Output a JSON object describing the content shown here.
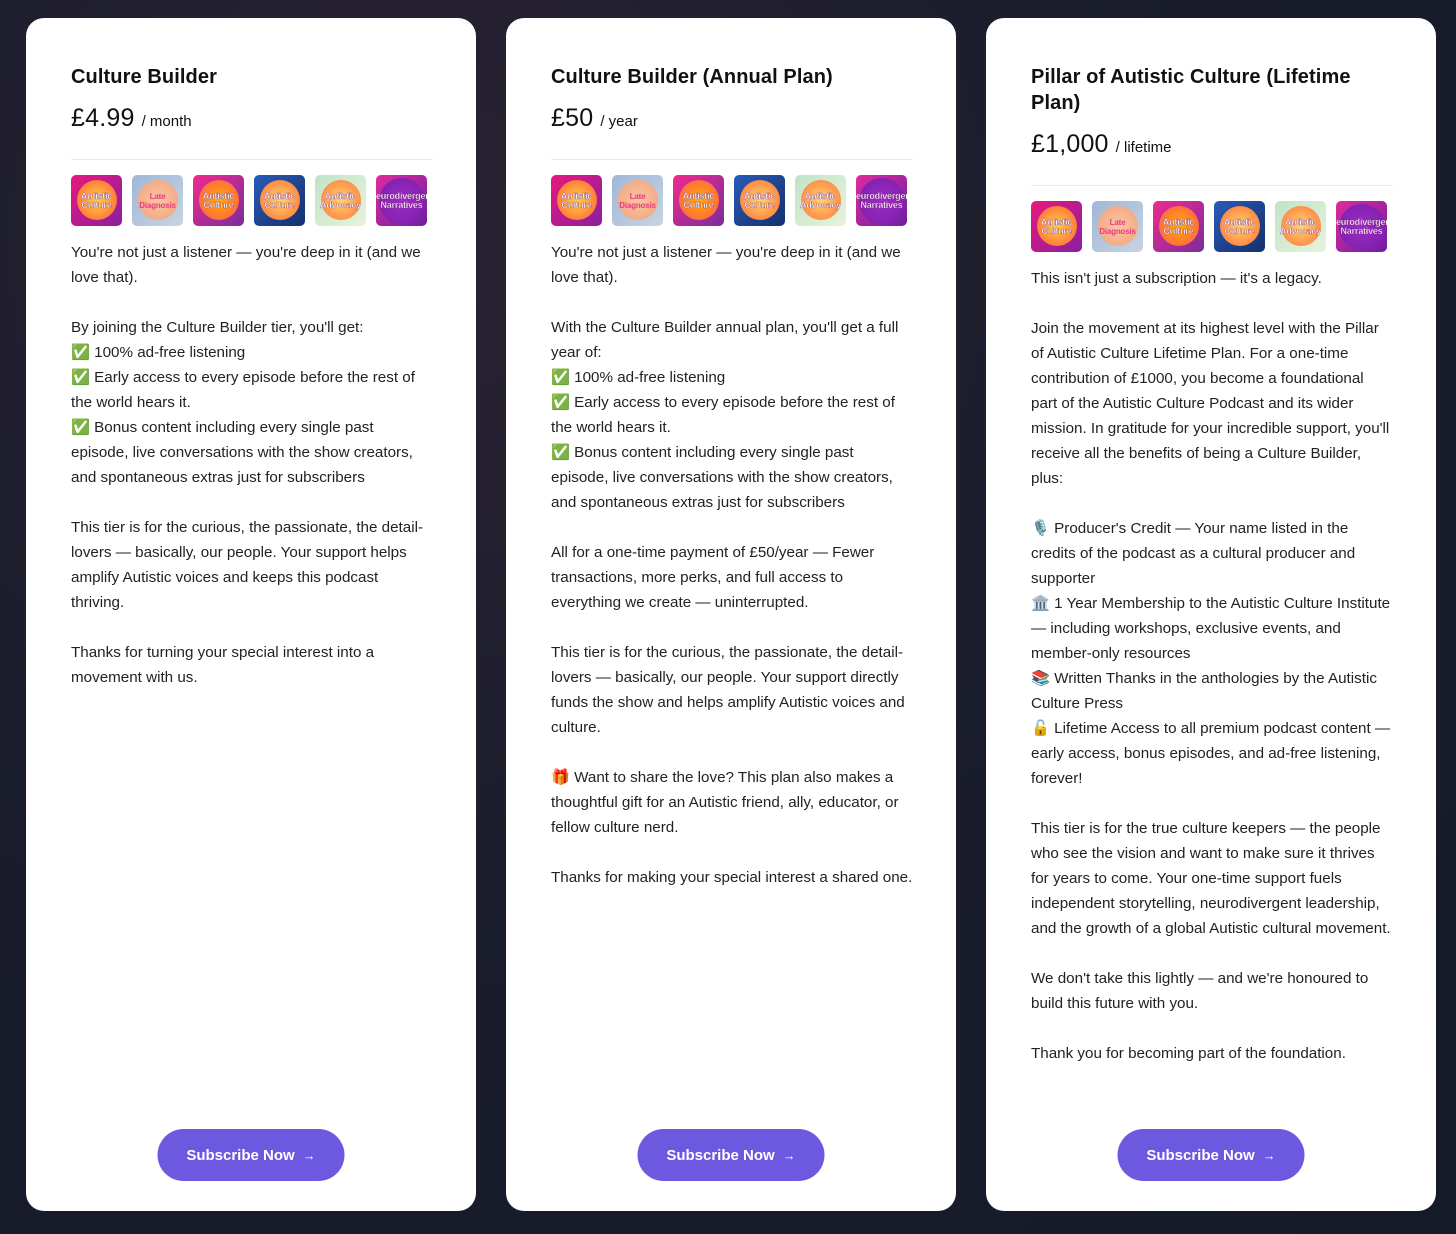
{
  "plans": [
    {
      "title": "Culture Builder",
      "price": "£4.99",
      "period": "/ month",
      "paragraphs": [
        [
          "You're not just a listener — you're deep in it (and we love that)."
        ],
        [
          "By joining the Culture Builder tier, you'll get:",
          "✅ 100% ad-free listening",
          "✅ Early access to every episode before the rest of the world hears it.",
          "✅ Bonus content including every single past episode, live conversations with the show creators, and spontaneous extras just for subscribers"
        ],
        [
          "This tier is for the curious, the passionate, the detail-lovers — basically, our people. Your support helps amplify Autistic voices and keeps this podcast thriving."
        ],
        [
          "Thanks for turning your special interest into a movement with us."
        ]
      ],
      "button_label": "Subscribe Now",
      "button_arrow": "→"
    },
    {
      "title": "Culture Builder (Annual Plan)",
      "price": "£50",
      "period": "/ year",
      "paragraphs": [
        [
          "You're not just a listener — you're deep in it (and we love that)."
        ],
        [
          "With the Culture Builder annual plan, you'll get a full year of:",
          "✅ 100% ad-free listening",
          "✅ Early access to every episode before the rest of the world hears it.",
          "✅ Bonus content including every single past episode, live conversations with the show creators, and spontaneous extras just for subscribers"
        ],
        [
          "All for a one-time payment of £50/year — Fewer transactions, more perks, and full access to everything we create — uninterrupted."
        ],
        [
          "This tier is for the curious, the passionate, the detail-lovers — basically, our people. Your support directly funds the show and helps amplify Autistic voices and culture."
        ],
        [
          "🎁 Want to share the love? This plan also makes a thoughtful gift for an Autistic friend, ally, educator, or fellow culture nerd."
        ],
        [
          "Thanks for making your special interest a shared one."
        ]
      ],
      "button_label": "Subscribe Now",
      "button_arrow": "→"
    },
    {
      "title": "Pillar of Autistic Culture (Lifetime Plan)",
      "price": "£1,000",
      "period": "/ lifetime",
      "paragraphs": [
        [
          "This isn't just a subscription — it's a legacy."
        ],
        [
          "Join the movement at its highest level with the Pillar of Autistic Culture Lifetime Plan. For a one-time contribution of £1000, you become a foundational part of the Autistic Culture Podcast and its wider mission. In gratitude for your incredible support, you'll receive all the benefits of being a Culture Builder, plus:"
        ],
        [
          "🎙️ Producer's Credit — Your name listed in the credits of the podcast as a cultural producer and supporter",
          "🏛️ 1 Year Membership to the Autistic Culture Institute — including workshops, exclusive events, and member-only resources",
          "📚 Written Thanks in the anthologies by the Autistic Culture Press",
          "🔓 Lifetime Access to all premium podcast content — early access, bonus episodes, and ad-free listening, forever!"
        ],
        [
          "This tier is for the true culture keepers — the people who see the vision and want to make sure it thrives for years to come. Your one-time support fuels independent storytelling, neurodivergent leadership, and the growth of a global Autistic cultural movement."
        ],
        [
          "We don't take this lightly — and we're honoured to build this future with you."
        ],
        [
          "Thank you for becoming part of the foundation."
        ]
      ],
      "button_label": "Subscribe Now",
      "button_arrow": "→"
    }
  ],
  "podcast_icons": [
    {
      "name": "autistic-culture-icon",
      "label": "Autistic Culture",
      "style": "ic-ac"
    },
    {
      "name": "late-diagnosis-icon",
      "label": "Late Diagnosis",
      "style": "ic-late"
    },
    {
      "name": "autistic-culture-plus-icon",
      "label": "Autistic Culture",
      "style": "ic-ac2"
    },
    {
      "name": "autistic-culture-blue-icon",
      "label": "Autistic Culture",
      "style": "ic-ac3"
    },
    {
      "name": "autistic-advocacy-icon",
      "label": "Autistic Advocacy",
      "style": "ic-adv"
    },
    {
      "name": "neurodivergent-narratives-icon",
      "label": "Neurodivergent Narratives",
      "style": "ic-nd"
    }
  ],
  "colors": {
    "button": "#6d59e0",
    "card": "#ffffff",
    "background": "#1b1d2c"
  }
}
